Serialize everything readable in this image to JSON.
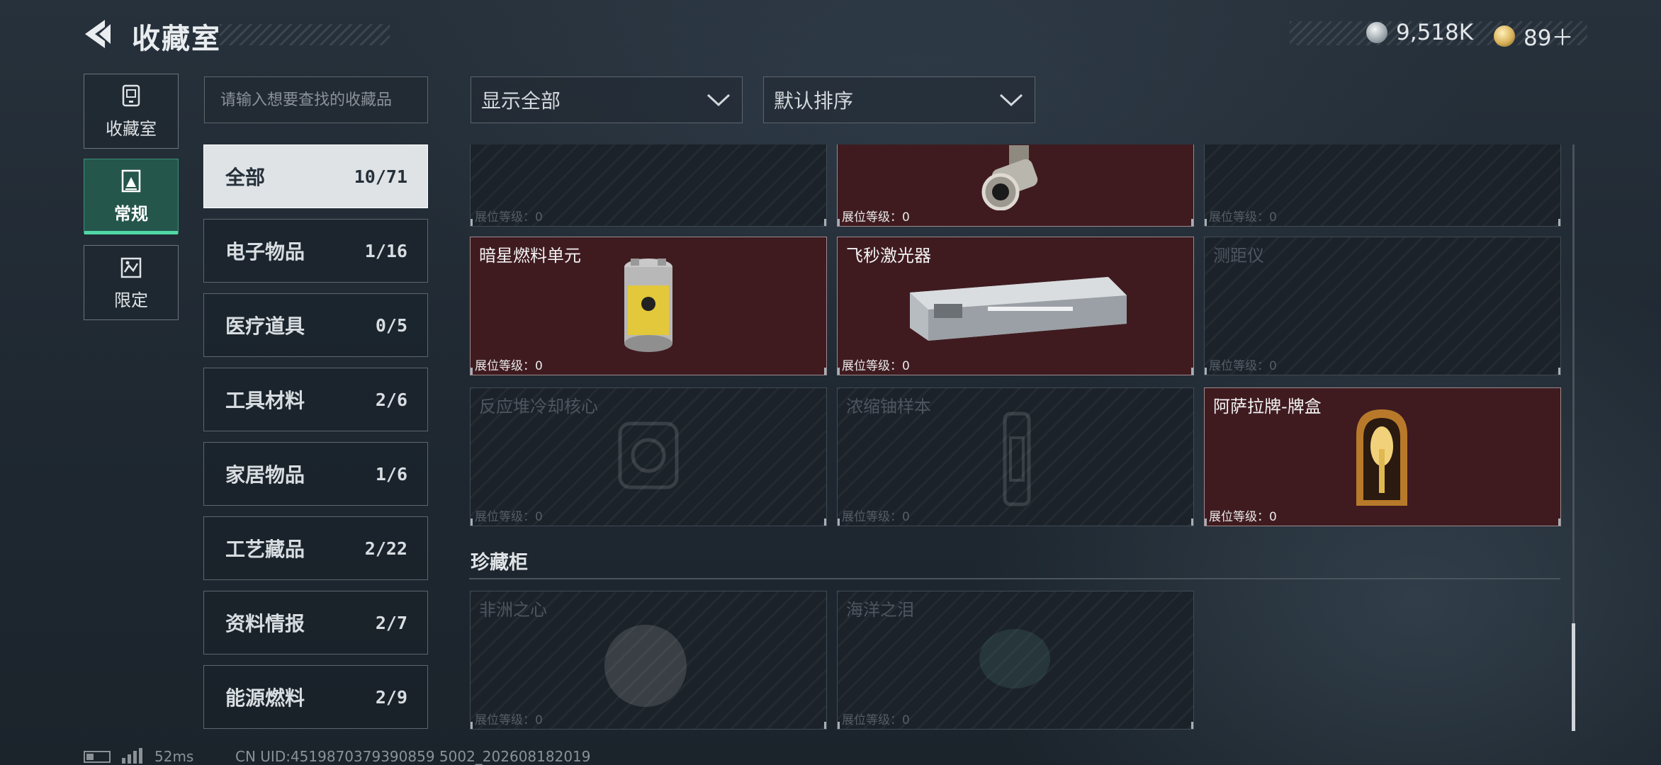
{
  "header": {
    "title": "收藏室",
    "currencies": [
      {
        "name": "silver-coin-icon",
        "value": "9,518K",
        "color": "#b8c0c6"
      },
      {
        "name": "gold-token-icon",
        "value": "89＋",
        "color": "#d8b25a"
      }
    ]
  },
  "side_nav": [
    {
      "label": "收藏室",
      "icon": "vault-icon",
      "active": false
    },
    {
      "label": "常规",
      "icon": "collection-icon",
      "active": true
    },
    {
      "label": "限定",
      "icon": "limited-icon",
      "active": false
    }
  ],
  "search": {
    "placeholder": "请输入想要查找的收藏品"
  },
  "filters": {
    "show": "显示全部",
    "sort": "默认排序"
  },
  "categories": [
    {
      "name": "全部",
      "count": "10/71",
      "active": true
    },
    {
      "name": "电子物品",
      "count": "1/16"
    },
    {
      "name": "医疗道具",
      "count": "0/5"
    },
    {
      "name": "工具材料",
      "count": "2/6"
    },
    {
      "name": "家居物品",
      "count": "1/6"
    },
    {
      "name": "工艺藏品",
      "count": "2/22"
    },
    {
      "name": "资料情报",
      "count": "2/7"
    },
    {
      "name": "能源燃料",
      "count": "2/9"
    }
  ],
  "items": [
    {
      "name": "",
      "level": "展位等级：0",
      "owned": false
    },
    {
      "name": "",
      "level": "展位等级：0",
      "owned": true
    },
    {
      "name": "",
      "level": "展位等级：0",
      "owned": false
    },
    {
      "name": "暗星燃料单元",
      "level": "展位等级：0",
      "owned": true
    },
    {
      "name": "飞秒激光器",
      "level": "展位等级：0",
      "owned": true
    },
    {
      "name": "测距仪",
      "level": "展位等级：0",
      "owned": false
    },
    {
      "name": "反应堆冷却核心",
      "level": "展位等级：0",
      "owned": false
    },
    {
      "name": "浓缩铀样本",
      "level": "展位等级：0",
      "owned": false
    },
    {
      "name": "阿萨拉牌-牌盒",
      "level": "展位等级：0",
      "owned": true
    }
  ],
  "treasure_section": {
    "title": "珍藏柜",
    "items": [
      {
        "name": "非洲之心",
        "level": "展位等级：0",
        "owned": false
      },
      {
        "name": "海洋之泪",
        "level": "展位等级：0",
        "owned": false
      }
    ]
  },
  "status_bar": {
    "ping": "52ms",
    "uid": "CN UID:4519870379390859 5002_202608182019"
  }
}
